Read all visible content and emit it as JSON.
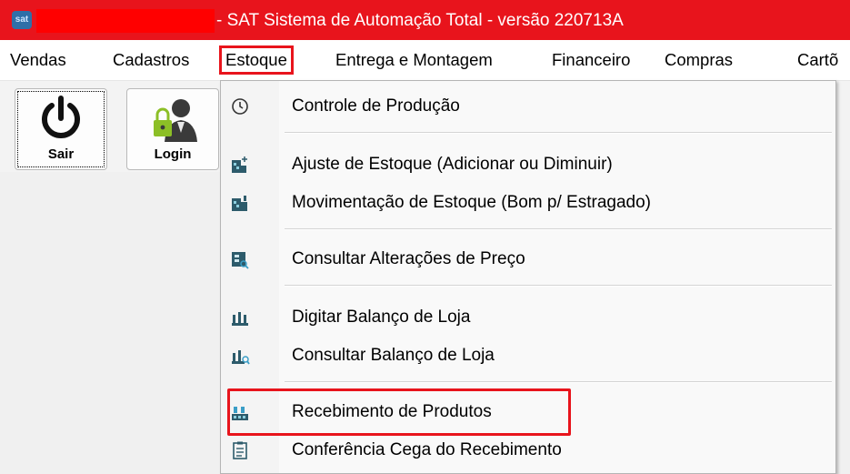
{
  "window": {
    "logo_text": "sat",
    "title": "- SAT Sistema de Automação Total - versão 220713A"
  },
  "menubar": {
    "items": [
      {
        "label": "Vendas"
      },
      {
        "label": "Cadastros"
      },
      {
        "label": "Estoque",
        "active": true
      },
      {
        "label": "Entrega e Montagem"
      },
      {
        "label": "Financeiro"
      },
      {
        "label": "Compras"
      },
      {
        "label": "Cartõ"
      }
    ]
  },
  "toolbar": {
    "buttons": [
      {
        "label": "Sair",
        "icon": "power-icon"
      },
      {
        "label": "Login",
        "icon": "user-lock-icon"
      }
    ]
  },
  "dropdown": {
    "items": [
      {
        "label": "Controle de Produção",
        "icon": "clock-icon"
      },
      {
        "label": "Ajuste de Estoque  (Adicionar ou Diminuir)",
        "icon": "stock-adjust-icon"
      },
      {
        "label": "Movimentação de Estoque (Bom p/ Estragado)",
        "icon": "stock-move-icon"
      },
      {
        "label": "Consultar Alterações de Preço",
        "icon": "price-search-icon"
      },
      {
        "label": "Digitar Balanço de Loja",
        "icon": "factory-icon"
      },
      {
        "label": "Consultar Balanço de Loja",
        "icon": "factory-search-icon"
      },
      {
        "label": "Recebimento de Produtos",
        "icon": "receiving-icon",
        "highlighted": true
      },
      {
        "label": "Conferência Cega do Recebimento",
        "icon": "checklist-icon"
      }
    ]
  },
  "colors": {
    "title_bar": "#e8141c",
    "highlight": "#e8141c",
    "menu_bg": "#f9f9f9"
  }
}
